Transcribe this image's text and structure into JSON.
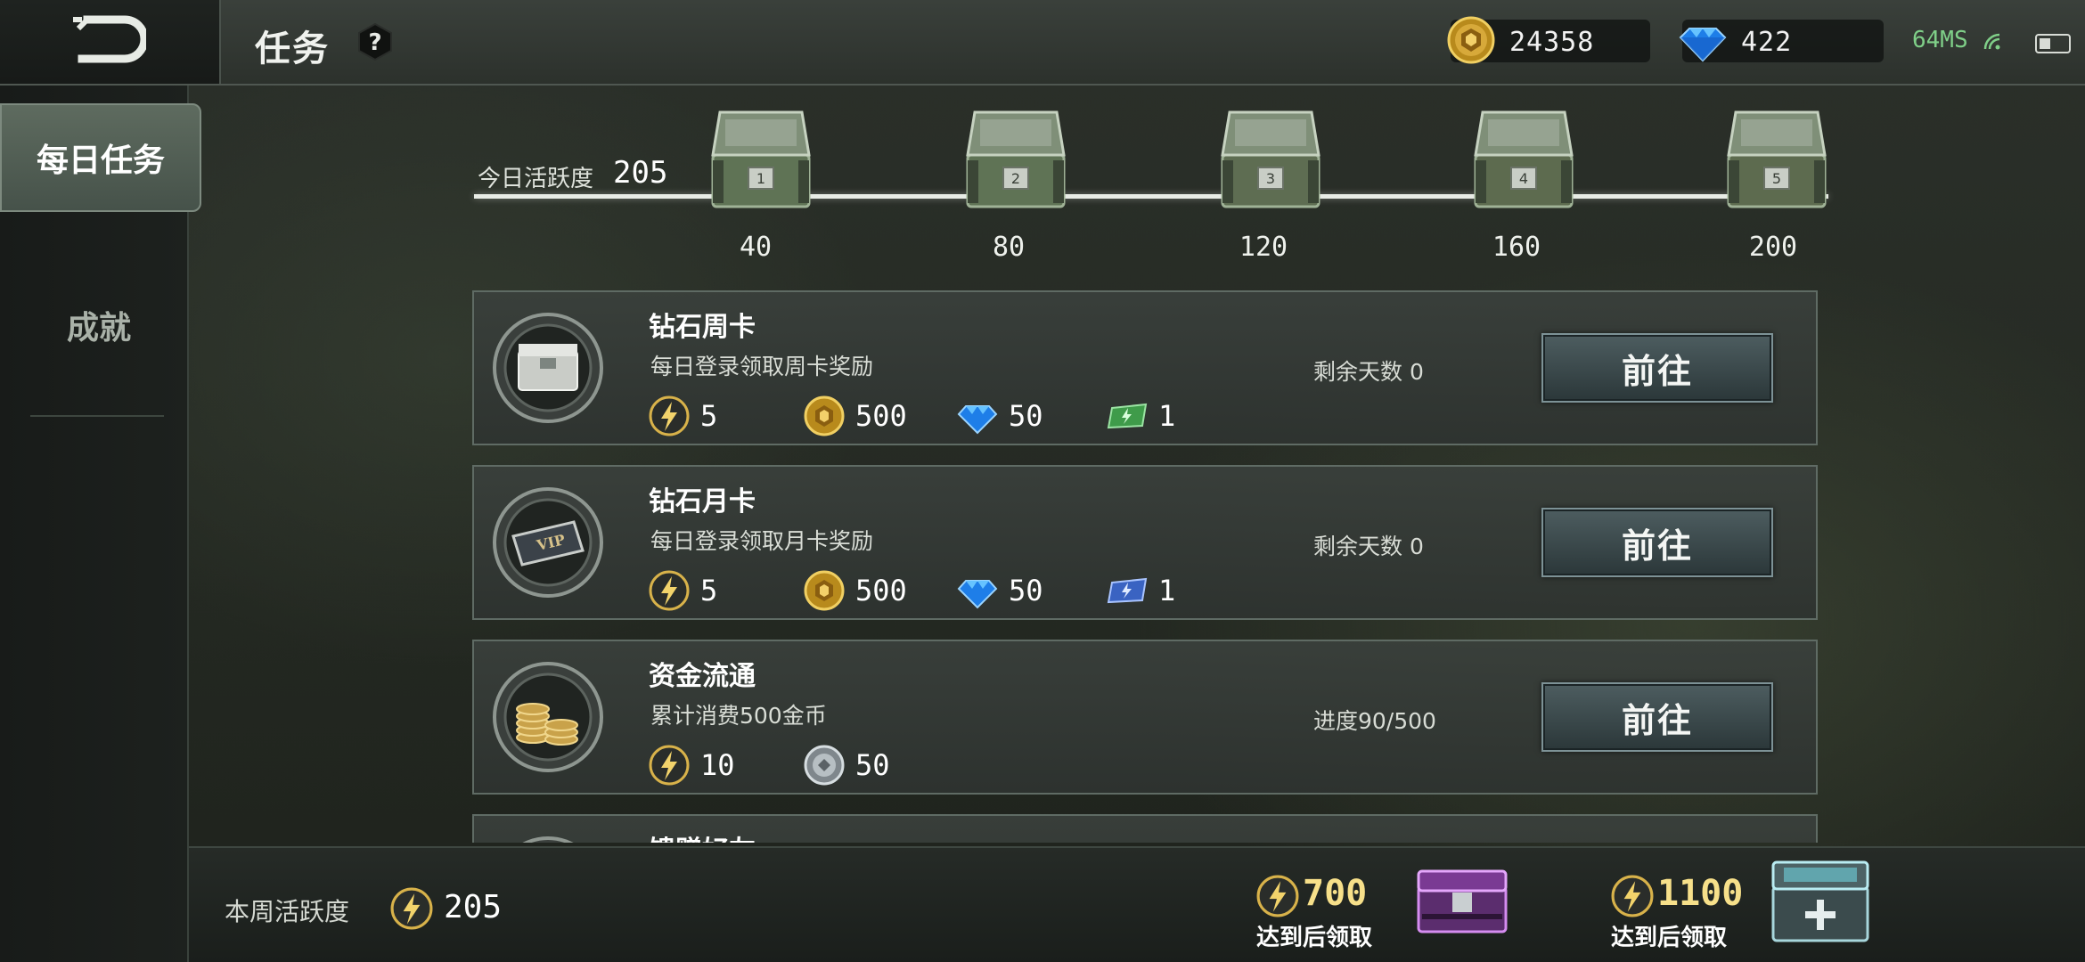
{
  "header": {
    "title": "任务",
    "gold": "24358",
    "diamonds": "422",
    "ping": "64MS"
  },
  "sidebar": {
    "items": [
      {
        "label": "每日任务",
        "active": true
      },
      {
        "label": "成就",
        "active": false
      }
    ]
  },
  "activity": {
    "label": "今日活跃度",
    "value": "205",
    "milestones": [
      "40",
      "80",
      "120",
      "160",
      "200"
    ],
    "chest_numbers": [
      "1",
      "2",
      "3",
      "4",
      "5"
    ]
  },
  "tasks": [
    {
      "title": "钻石周卡",
      "desc": "每日登录领取周卡奖励",
      "status": "剩余天数 0",
      "button": "前往",
      "rewards": [
        {
          "icon": "activity-bolt-icon",
          "value": "5"
        },
        {
          "icon": "gold-coin-icon",
          "value": "500"
        },
        {
          "icon": "diamond-icon",
          "value": "50"
        },
        {
          "icon": "green-ticket-icon",
          "value": "1"
        }
      ]
    },
    {
      "title": "钻石月卡",
      "desc": "每日登录领取月卡奖励",
      "status": "剩余天数 0",
      "button": "前往",
      "rewards": [
        {
          "icon": "activity-bolt-icon",
          "value": "5"
        },
        {
          "icon": "gold-coin-icon",
          "value": "500"
        },
        {
          "icon": "diamond-icon",
          "value": "50"
        },
        {
          "icon": "blue-ticket-icon",
          "value": "1"
        }
      ]
    },
    {
      "title": "资金流通",
      "desc": "累计消费500金币",
      "status": "进度90/500",
      "button": "前往",
      "rewards": [
        {
          "icon": "activity-bolt-icon",
          "value": "10"
        },
        {
          "icon": "silver-coin-icon",
          "value": "50"
        }
      ]
    },
    {
      "title": "馈赠好友"
    }
  ],
  "footer": {
    "week_label": "本周活跃度",
    "week_value": "205",
    "goals": [
      {
        "value": "700",
        "label": "达到后领取"
      },
      {
        "value": "1100",
        "label": "达到后领取"
      }
    ]
  },
  "colors": {
    "gold_text": "#f7e08a",
    "ping_green": "#7fcf88",
    "button_top": "#4d5d60",
    "card_border": "#5f6b64"
  }
}
